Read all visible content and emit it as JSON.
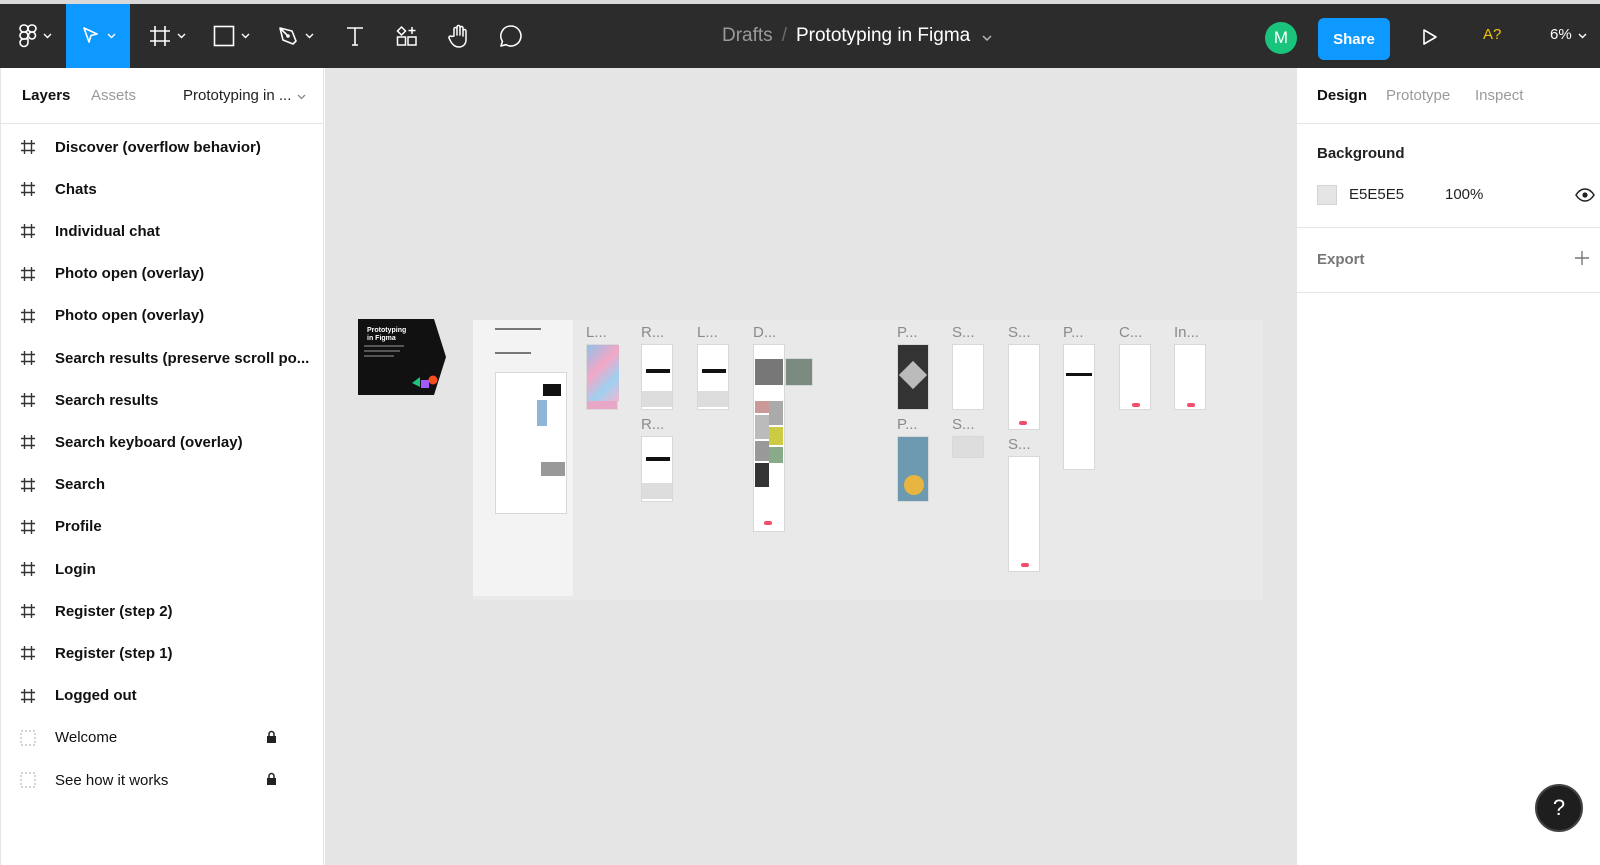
{
  "toolbar": {
    "breadcrumb_parent": "Drafts",
    "breadcrumb_separator": "/",
    "file_name": "Prototyping in Figma",
    "avatar_initial": "M",
    "share_label": "Share",
    "accessibility_label": "A?",
    "zoom_level": "6%",
    "icons": [
      "figma-menu-icon",
      "move-tool-icon",
      "frame-tool-icon",
      "rectangle-tool-icon",
      "pen-tool-icon",
      "text-tool-icon",
      "resources-icon",
      "hand-tool-icon",
      "comment-tool-icon",
      "present-icon"
    ]
  },
  "left_panel": {
    "tabs": [
      "Layers",
      "Assets"
    ],
    "page_selector": "Prototyping in ...",
    "layers": [
      {
        "name": "Discover (overflow behavior)",
        "type": "frame"
      },
      {
        "name": "Chats",
        "type": "frame"
      },
      {
        "name": "Individual chat",
        "type": "frame"
      },
      {
        "name": "Photo open (overlay)",
        "type": "frame"
      },
      {
        "name": "Photo open (overlay)",
        "type": "frame"
      },
      {
        "name": "Search results (preserve scroll po...",
        "type": "frame"
      },
      {
        "name": "Search results",
        "type": "frame"
      },
      {
        "name": "Search keyboard (overlay)",
        "type": "frame"
      },
      {
        "name": "Search",
        "type": "frame"
      },
      {
        "name": "Profile",
        "type": "frame"
      },
      {
        "name": "Login",
        "type": "frame"
      },
      {
        "name": "Register (step 2)",
        "type": "frame"
      },
      {
        "name": "Register (step 1)",
        "type": "frame"
      },
      {
        "name": "Logged out",
        "type": "frame"
      },
      {
        "name": "Welcome",
        "type": "group",
        "locked": true
      },
      {
        "name": "See how it works",
        "type": "group",
        "locked": true
      }
    ]
  },
  "canvas": {
    "background": "#E5E5E5",
    "cover_title_line1": "Prototyping",
    "cover_title_line2": "in Figma",
    "frame_labels": [
      "L...",
      "R...",
      "L...",
      "D...",
      "P...",
      "S...",
      "S...",
      "P...",
      "C...",
      "In...",
      "R...",
      "P...",
      "S...",
      "S..."
    ]
  },
  "right_panel": {
    "tabs": [
      "Design",
      "Prototype",
      "Inspect"
    ],
    "background_title": "Background",
    "background_hex": "E5E5E5",
    "background_opacity": "100%",
    "export_title": "Export"
  },
  "help_label": "?"
}
